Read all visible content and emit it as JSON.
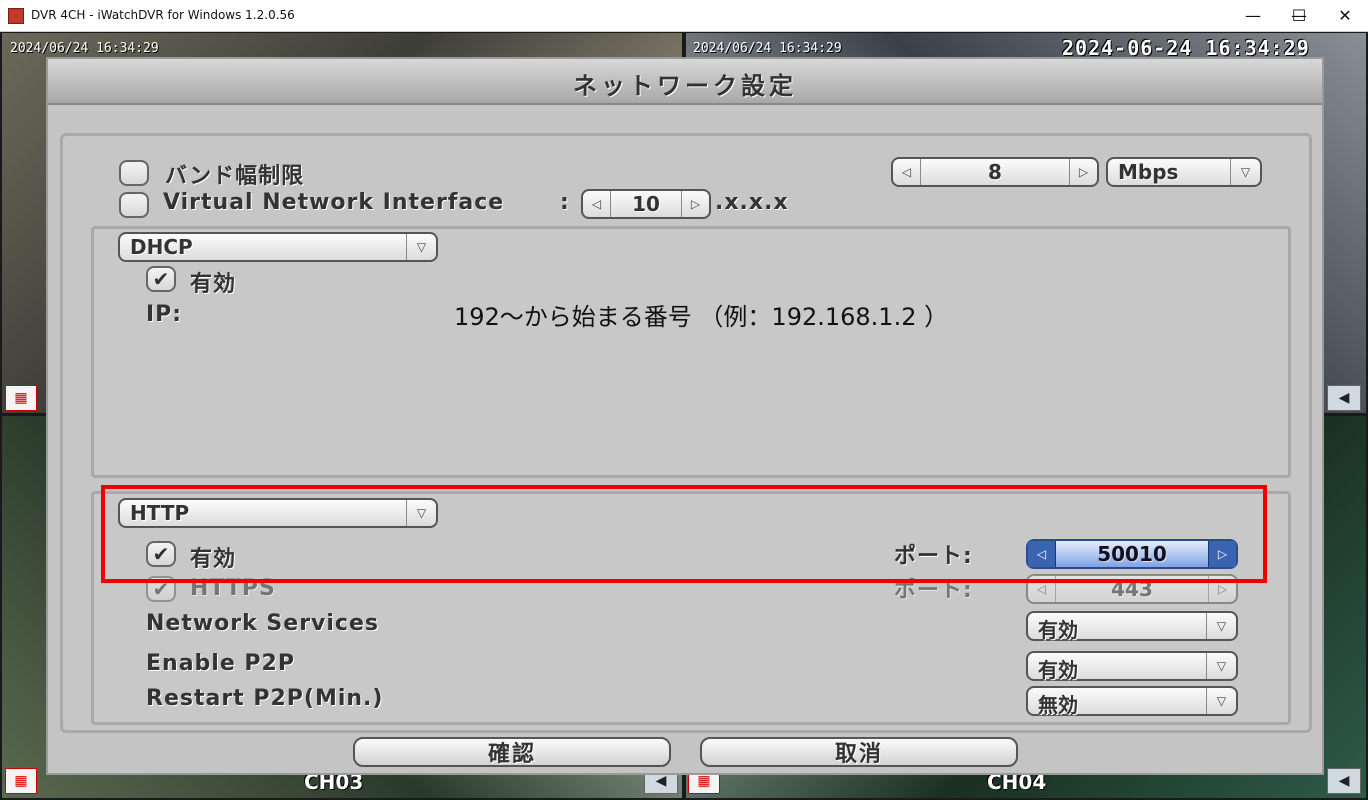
{
  "window": {
    "title": "DVR 4CH - iWatchDVR for Windows 1.2.0.56",
    "minimize": "—",
    "maximize": "☐",
    "close": "✕"
  },
  "osd": {
    "timestamp_ch1": "2024/06/24 16:34:29",
    "timestamp_ch2": "2024/06/24 16:34:29",
    "clock": "2024-06-24 16:34:29",
    "ch3": "CH03",
    "ch4": "CH04"
  },
  "dialog": {
    "title": "ネットワーク設定",
    "bandwidth": {
      "label": "バンド幅制限",
      "value": "8",
      "unit": "Mbps"
    },
    "vni": {
      "label": "Virtual Network Interface",
      "colon": ":",
      "value": "10",
      "suffix": ".x.x.x"
    },
    "network_mode": {
      "selected": "DHCP",
      "enable_label": "有効",
      "ip_label": "IP:",
      "ip_note": "192～から始まる番号 （例：192.168.1.2 ）"
    },
    "http": {
      "selected": "HTTP",
      "enable_label": "有効",
      "port_label": "ポート:",
      "port_value": "50010",
      "https_label": "HTTPS",
      "https_port_label": "ポート:",
      "https_port_value": "443"
    },
    "network_services": {
      "label": "Network Services",
      "value": "有効"
    },
    "enable_p2p": {
      "label": "Enable P2P",
      "value": "有効"
    },
    "restart_p2p": {
      "label": "Restart P2P(Min.)",
      "value": "無効"
    },
    "ok_label": "確認",
    "cancel_label": "取消"
  },
  "colors": {
    "highlight_box": "#e00000",
    "active_spin": "#3a63b0"
  }
}
